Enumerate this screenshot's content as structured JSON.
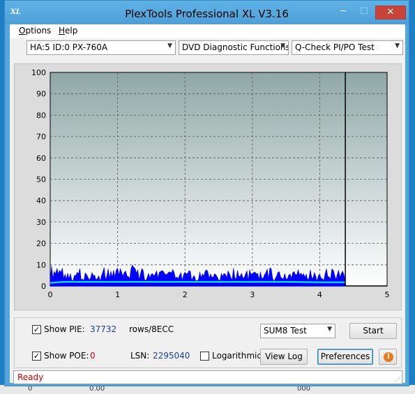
{
  "window": {
    "title": "PlexTools Professional XL V3.16",
    "icon_text": "XL",
    "min_glyph": "─",
    "max_glyph": "☐",
    "close_glyph": "✕"
  },
  "menu": {
    "options_accel": "O",
    "options_rest": "ptions",
    "help_accel": "H",
    "help_rest": "elp"
  },
  "toolbar": {
    "drive": "HA:5 ID:0  PX-760A",
    "function": "DVD Diagnostic Functions",
    "test": "Q-Check PI/PO Test"
  },
  "chart_data": {
    "type": "area",
    "x_ticks": [
      "0",
      "1",
      "2",
      "3",
      "4",
      "5"
    ],
    "y_ticks": [
      "0",
      "10",
      "20",
      "30",
      "40",
      "50",
      "60",
      "70",
      "80",
      "90",
      "100"
    ],
    "xlim": [
      0,
      5
    ],
    "ylim": [
      0,
      100
    ],
    "grid": true,
    "end_marker_x": 4.38,
    "series": [
      {
        "color": "#0000ff",
        "x": [
          0.0,
          0.1,
          0.2,
          0.3,
          0.4,
          0.5,
          0.6,
          0.7,
          0.8,
          0.9,
          1.0,
          1.1,
          1.2,
          1.3,
          1.4,
          1.5,
          1.6,
          1.7,
          1.8,
          1.9,
          2.0,
          2.1,
          2.2,
          2.3,
          2.4,
          2.5,
          2.6,
          2.7,
          2.8,
          2.9,
          3.0,
          3.1,
          3.2,
          3.3,
          3.4,
          3.5,
          3.6,
          3.7,
          3.8,
          3.9,
          4.0,
          4.1,
          4.2,
          4.3,
          4.38
        ],
        "values": [
          9,
          8,
          7,
          7,
          8,
          6,
          7,
          6,
          8,
          7,
          8,
          7,
          9,
          8,
          6,
          7,
          7,
          6,
          8,
          6,
          7,
          6,
          7,
          8,
          7,
          6,
          7,
          8,
          6,
          7,
          6,
          7,
          8,
          6,
          7,
          6,
          7,
          6,
          7,
          6,
          7,
          8,
          7,
          8,
          7
        ]
      },
      {
        "color": "#00ffff",
        "x": [
          0.0,
          0.2,
          0.5,
          1.0,
          1.5,
          2.0,
          2.5,
          3.0,
          3.5,
          4.0,
          4.38
        ],
        "values": [
          1.5,
          2,
          2,
          2,
          2,
          2,
          2,
          2,
          2,
          1.8,
          1.8
        ]
      }
    ]
  },
  "panel": {
    "show_pie_label": "Show PIE:",
    "pie_value": "37732",
    "pie_unit": "rows/8ECC",
    "show_poe_label": "Show POE:",
    "poe_value": "0",
    "lsn_label": "LSN:",
    "lsn_value": "2295040",
    "logarithmic_label": "Logarithmic",
    "sum_test": "SUM8 Test",
    "start_label": "Start",
    "view_log_label": "View Log",
    "preferences_label": "Preferences",
    "check_glyph": "✓",
    "info_glyph": "i"
  },
  "status": {
    "text": "Ready"
  },
  "desktop": {
    "left_text": "0",
    "mid_text": "0.00",
    "right_text": "000"
  },
  "icons": {
    "app": "app-logo-icon",
    "dropdown": "chevron-down-icon",
    "info": "info-icon"
  }
}
